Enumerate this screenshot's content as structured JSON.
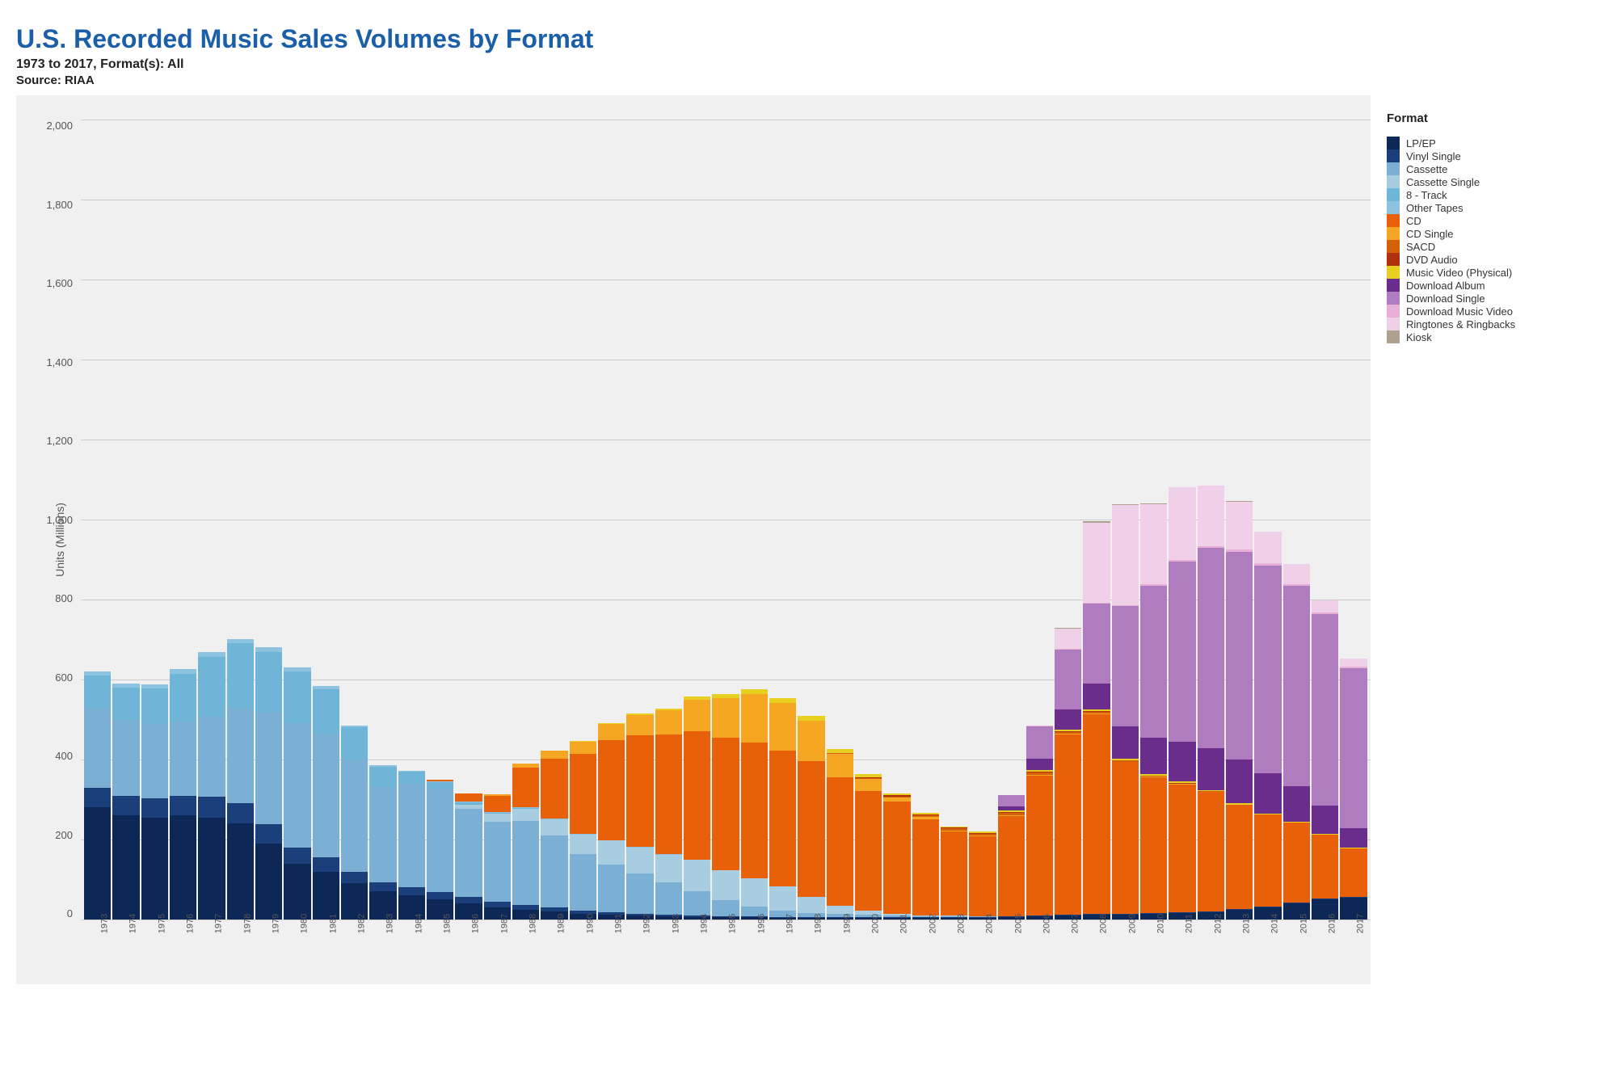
{
  "title": "U.S. Recorded Music Sales Volumes by Format",
  "subtitle": "1973 to 2017, Format(s): All",
  "source": "Source: RIAA",
  "yAxis": {
    "title": "Units (Millions)",
    "labels": [
      "2,000",
      "1,800",
      "1,600",
      "1,400",
      "1,200",
      "1,000",
      "800",
      "600",
      "400",
      "200",
      "0"
    ]
  },
  "legend": {
    "title": "Format",
    "items": [
      {
        "label": "LP/EP",
        "color": "#0d2857"
      },
      {
        "label": "Vinyl Single",
        "color": "#1a3f7a"
      },
      {
        "label": "Cassette",
        "color": "#7bafd4"
      },
      {
        "label": "Cassette Single",
        "color": "#a8cce0"
      },
      {
        "label": "8 - Track",
        "color": "#6eb5d8"
      },
      {
        "label": "Other Tapes",
        "color": "#8dc3e0"
      },
      {
        "label": "CD",
        "color": "#e8610a"
      },
      {
        "label": "CD Single",
        "color": "#f5a623"
      },
      {
        "label": "SACD",
        "color": "#d4600a"
      },
      {
        "label": "DVD Audio",
        "color": "#b03010"
      },
      {
        "label": "Music Video (Physical)",
        "color": "#e8d020"
      },
      {
        "label": "Download Album",
        "color": "#6b2d8b"
      },
      {
        "label": "Download Single",
        "color": "#b07cc0"
      },
      {
        "label": "Download Music Video",
        "color": "#e8b0d8"
      },
      {
        "label": "Ringtones & Ringbacks",
        "color": "#f0d0e8"
      },
      {
        "label": "Kiosk",
        "color": "#b0a090"
      }
    ]
  },
  "years": [
    "1973",
    "1974",
    "1975",
    "1976",
    "1977",
    "1978",
    "1979",
    "1980",
    "1981",
    "1982",
    "1983",
    "1984",
    "1985",
    "1986",
    "1987",
    "1988",
    "1989",
    "1990",
    "1991",
    "1992",
    "1993",
    "1994",
    "1995",
    "1996",
    "1997",
    "1998",
    "1999",
    "2000",
    "2001",
    "2002",
    "2003",
    "2004",
    "2005",
    "2006",
    "2007",
    "2008",
    "2009",
    "2010",
    "2011",
    "2012",
    "2013",
    "2014",
    "2015",
    "2016",
    "2017"
  ],
  "data": {
    "lp_ep": [
      280,
      260,
      255,
      260,
      255,
      240,
      190,
      140,
      120,
      90,
      70,
      60,
      50,
      40,
      30,
      25,
      20,
      15,
      12,
      10,
      8,
      7,
      7,
      6,
      5,
      5,
      5,
      5,
      5,
      5,
      5,
      5,
      6,
      8,
      10,
      12,
      12,
      14,
      16,
      18,
      25,
      30,
      40,
      50,
      55
    ],
    "vinyl_single": [
      50,
      50,
      48,
      50,
      52,
      50,
      48,
      40,
      35,
      30,
      22,
      20,
      18,
      16,
      14,
      12,
      10,
      8,
      6,
      5,
      4,
      3,
      2,
      2,
      2,
      2,
      2,
      2,
      2,
      2,
      2,
      2,
      2,
      2,
      2,
      2,
      2,
      2,
      2,
      2,
      2,
      2,
      2,
      2,
      2
    ],
    "cassette": [
      200,
      190,
      185,
      185,
      200,
      240,
      280,
      310,
      310,
      280,
      240,
      260,
      260,
      220,
      200,
      210,
      180,
      140,
      120,
      100,
      80,
      60,
      40,
      25,
      15,
      10,
      8,
      5,
      3,
      2,
      2,
      1,
      1,
      0,
      0,
      0,
      0,
      0,
      0,
      0,
      0,
      0,
      0,
      0,
      0
    ],
    "cassette_single": [
      0,
      0,
      0,
      0,
      0,
      0,
      0,
      0,
      0,
      0,
      0,
      0,
      0,
      10,
      20,
      30,
      40,
      50,
      60,
      65,
      70,
      80,
      75,
      70,
      60,
      40,
      20,
      10,
      5,
      2,
      1,
      0,
      0,
      0,
      0,
      0,
      0,
      0,
      0,
      0,
      0,
      0,
      0,
      0,
      0
    ],
    "eight_track": [
      80,
      80,
      90,
      120,
      150,
      160,
      150,
      130,
      110,
      80,
      50,
      30,
      15,
      8,
      3,
      1,
      0,
      0,
      0,
      0,
      0,
      0,
      0,
      0,
      0,
      0,
      0,
      0,
      0,
      0,
      0,
      0,
      0,
      0,
      0,
      0,
      0,
      0,
      0,
      0,
      0,
      0,
      0,
      0,
      0
    ],
    "other_tapes": [
      10,
      10,
      10,
      12,
      12,
      12,
      12,
      10,
      8,
      5,
      3,
      2,
      2,
      2,
      2,
      2,
      2,
      2,
      1,
      1,
      1,
      0,
      0,
      0,
      0,
      0,
      0,
      0,
      0,
      0,
      0,
      0,
      0,
      0,
      0,
      0,
      0,
      0,
      0,
      0,
      0,
      0,
      0,
      0,
      0
    ],
    "cd": [
      0,
      0,
      0,
      0,
      0,
      0,
      0,
      0,
      0,
      0,
      0,
      0,
      5,
      20,
      40,
      100,
      150,
      200,
      250,
      280,
      300,
      320,
      330,
      340,
      340,
      340,
      320,
      300,
      280,
      240,
      210,
      200,
      250,
      350,
      450,
      500,
      380,
      340,
      320,
      300,
      260,
      230,
      200,
      160,
      120
    ],
    "cd_single": [
      0,
      0,
      0,
      0,
      0,
      0,
      0,
      0,
      0,
      0,
      0,
      0,
      0,
      0,
      5,
      10,
      20,
      30,
      40,
      50,
      60,
      80,
      100,
      120,
      120,
      100,
      60,
      30,
      10,
      5,
      3,
      2,
      2,
      2,
      2,
      2,
      1,
      1,
      1,
      0,
      0,
      0,
      0,
      0,
      0
    ],
    "sacd": [
      0,
      0,
      0,
      0,
      0,
      0,
      0,
      0,
      0,
      0,
      0,
      0,
      0,
      0,
      0,
      0,
      0,
      0,
      0,
      0,
      0,
      0,
      0,
      0,
      0,
      0,
      1,
      2,
      3,
      4,
      5,
      5,
      5,
      5,
      5,
      4,
      3,
      2,
      1,
      1,
      0,
      0,
      0,
      0,
      0
    ],
    "dvd_audio": [
      0,
      0,
      0,
      0,
      0,
      0,
      0,
      0,
      0,
      0,
      0,
      0,
      0,
      0,
      0,
      0,
      0,
      0,
      0,
      0,
      0,
      0,
      0,
      0,
      0,
      0,
      1,
      2,
      3,
      2,
      2,
      2,
      2,
      2,
      2,
      2,
      1,
      1,
      1,
      0,
      0,
      0,
      0,
      0,
      0
    ],
    "music_video": [
      0,
      0,
      0,
      0,
      0,
      0,
      0,
      0,
      0,
      0,
      0,
      0,
      0,
      0,
      0,
      0,
      0,
      2,
      3,
      4,
      5,
      8,
      10,
      12,
      12,
      12,
      10,
      8,
      5,
      4,
      3,
      3,
      4,
      4,
      4,
      4,
      4,
      4,
      4,
      3,
      3,
      3,
      2,
      2,
      2
    ],
    "dl_album": [
      0,
      0,
      0,
      0,
      0,
      0,
      0,
      0,
      0,
      0,
      0,
      0,
      0,
      0,
      0,
      0,
      0,
      0,
      0,
      0,
      0,
      0,
      0,
      0,
      0,
      0,
      0,
      0,
      0,
      0,
      0,
      0,
      10,
      30,
      50,
      65,
      80,
      90,
      100,
      105,
      110,
      100,
      90,
      70,
      50
    ],
    "dl_single": [
      0,
      0,
      0,
      0,
      0,
      0,
      0,
      0,
      0,
      0,
      0,
      0,
      0,
      0,
      0,
      0,
      0,
      0,
      0,
      0,
      0,
      0,
      0,
      0,
      0,
      0,
      0,
      0,
      0,
      0,
      0,
      0,
      30,
      80,
      150,
      200,
      300,
      380,
      450,
      500,
      520,
      520,
      500,
      480,
      400
    ],
    "dl_video": [
      0,
      0,
      0,
      0,
      0,
      0,
      0,
      0,
      0,
      0,
      0,
      0,
      0,
      0,
      0,
      0,
      0,
      0,
      0,
      0,
      0,
      0,
      0,
      0,
      0,
      0,
      0,
      0,
      0,
      0,
      0,
      0,
      0,
      1,
      2,
      2,
      3,
      4,
      5,
      5,
      5,
      5,
      4,
      4,
      3
    ],
    "ringtones": [
      0,
      0,
      0,
      0,
      0,
      0,
      0,
      0,
      0,
      0,
      0,
      0,
      0,
      0,
      0,
      0,
      0,
      0,
      0,
      0,
      0,
      0,
      0,
      0,
      0,
      0,
      0,
      0,
      0,
      0,
      0,
      0,
      0,
      0,
      50,
      200,
      250,
      200,
      180,
      150,
      120,
      80,
      50,
      30,
      20
    ],
    "kiosk": [
      0,
      0,
      0,
      0,
      0,
      0,
      0,
      0,
      0,
      0,
      0,
      0,
      0,
      0,
      0,
      0,
      0,
      0,
      0,
      0,
      0,
      0,
      0,
      0,
      0,
      0,
      0,
      0,
      0,
      0,
      0,
      0,
      0,
      0,
      2,
      3,
      3,
      2,
      2,
      1,
      1,
      0,
      0,
      0,
      0
    ]
  }
}
